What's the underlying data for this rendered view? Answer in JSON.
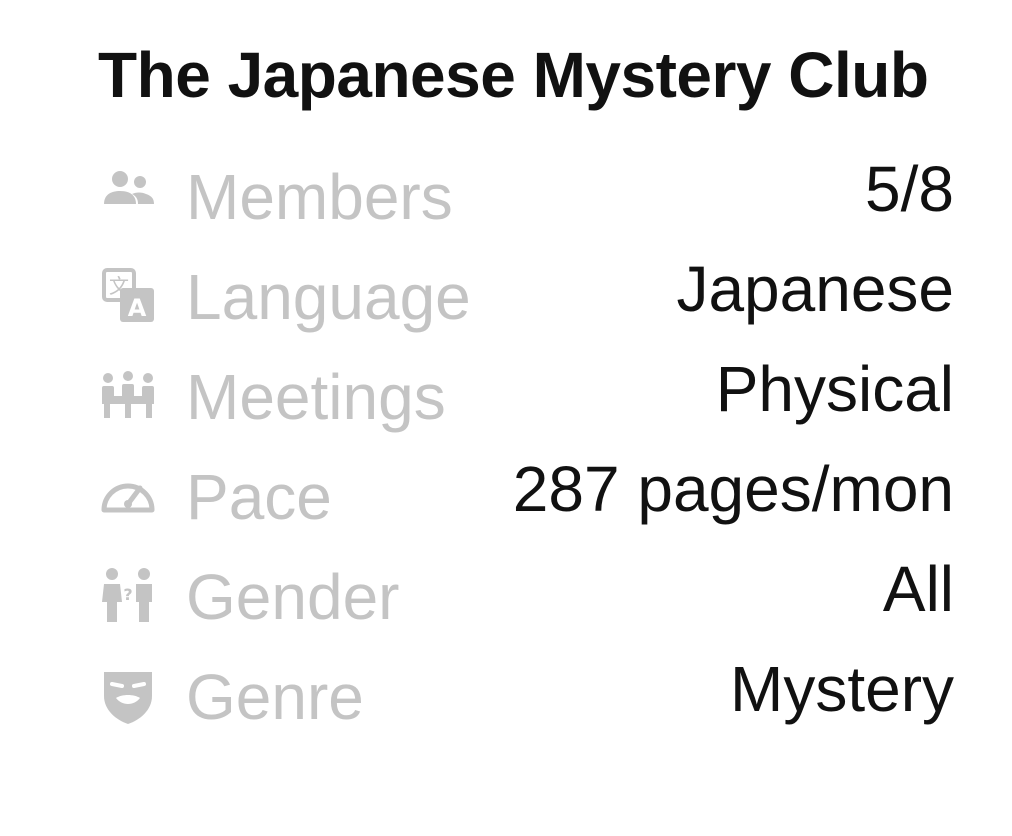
{
  "club": {
    "title": "The Japanese Mystery Club"
  },
  "details": [
    {
      "label": "Members",
      "value": "5/8",
      "icon": "members-icon"
    },
    {
      "label": "Language",
      "value": "Japanese",
      "icon": "translate-icon"
    },
    {
      "label": "Meetings",
      "value": "Physical",
      "icon": "meetings-icon"
    },
    {
      "label": "Pace",
      "value": "287 pages/mon",
      "icon": "speedometer-icon"
    },
    {
      "label": "Gender",
      "value": "All",
      "icon": "gender-icon"
    },
    {
      "label": "Genre",
      "value": "Mystery",
      "icon": "theater-mask-icon"
    }
  ],
  "colors": {
    "title": "#111111",
    "label": "#c4c4c4",
    "icon": "#c4c4c4",
    "value": "#111111"
  }
}
